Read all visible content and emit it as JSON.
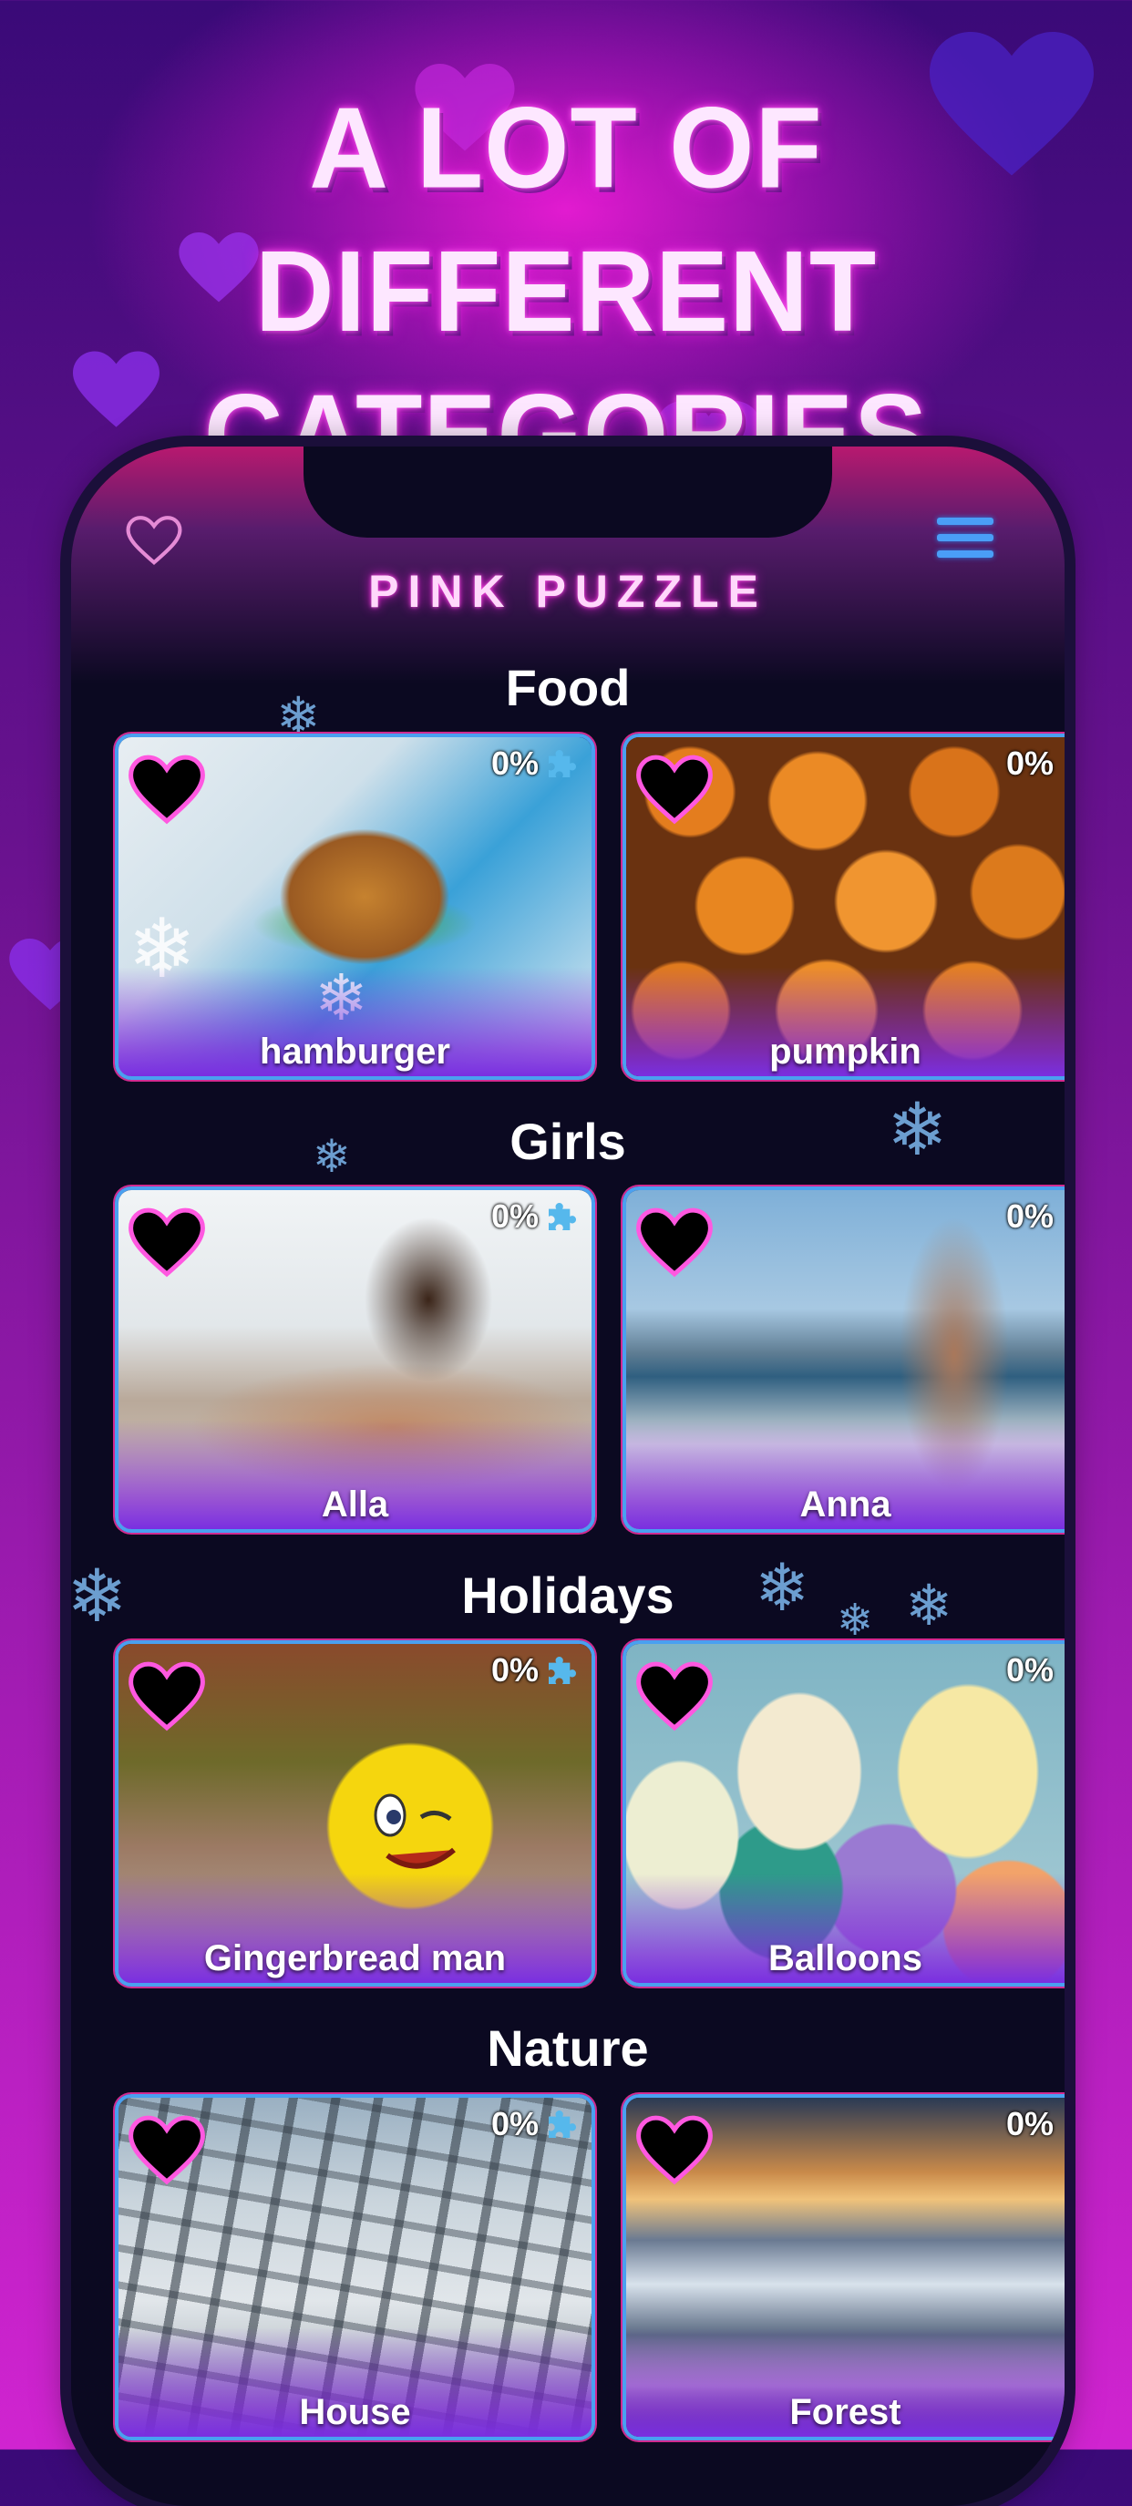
{
  "headline": {
    "line1": "A LOT OF DIFFERENT",
    "line2": "CATEGORIES"
  },
  "app": {
    "title": "PINK PUZZLE"
  },
  "icons": {
    "favorites": "heart-icon",
    "menu": "menu-icon",
    "progress": "puzzle-piece-icon",
    "like": "heart-icon"
  },
  "colors": {
    "accent_blue": "#4aa0f0",
    "accent_pink": "#e21ad0",
    "background": "#0b0921"
  },
  "categories": [
    {
      "title": "Food",
      "items": [
        {
          "label": "hamburger",
          "progress": "0%"
        },
        {
          "label": "pumpkin",
          "progress": "0%"
        }
      ]
    },
    {
      "title": "Girls",
      "items": [
        {
          "label": "Alla",
          "progress": "0%"
        },
        {
          "label": "Anna",
          "progress": "0%"
        }
      ]
    },
    {
      "title": "Holidays",
      "items": [
        {
          "label": "Gingerbread man",
          "progress": "0%"
        },
        {
          "label": "Balloons",
          "progress": "0%"
        }
      ]
    },
    {
      "title": "Nature",
      "items": [
        {
          "label": "House",
          "progress": "0%"
        },
        {
          "label": "Forest",
          "progress": "0%"
        }
      ]
    }
  ]
}
